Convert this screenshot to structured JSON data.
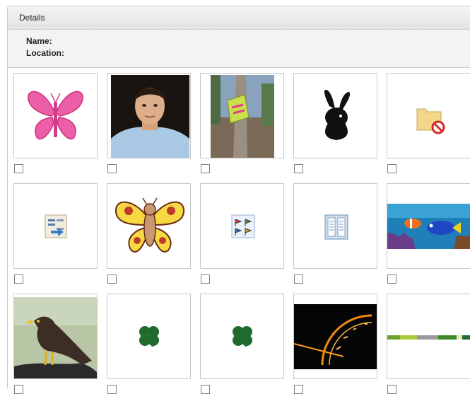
{
  "panel": {
    "title": "Details"
  },
  "details": {
    "name_label": "Name:",
    "location_label": "Location:"
  },
  "icons": [
    "pink-butterfly",
    "man-portrait",
    "tree-with-sign",
    "bunny-silhouette",
    "folder-forbidden",
    "document-swap",
    "cartoon-butterfly",
    "flags-checklist",
    "open-book",
    "clownfish-aquarium",
    "myna-bird",
    "four-leaf-clover",
    "four-leaf-clover",
    "speedometer",
    "color-bar-strip"
  ],
  "colors": {
    "border": "#c8c8c8",
    "header_bg": "#e6e6e6",
    "details_bg": "#f3f3f3"
  }
}
